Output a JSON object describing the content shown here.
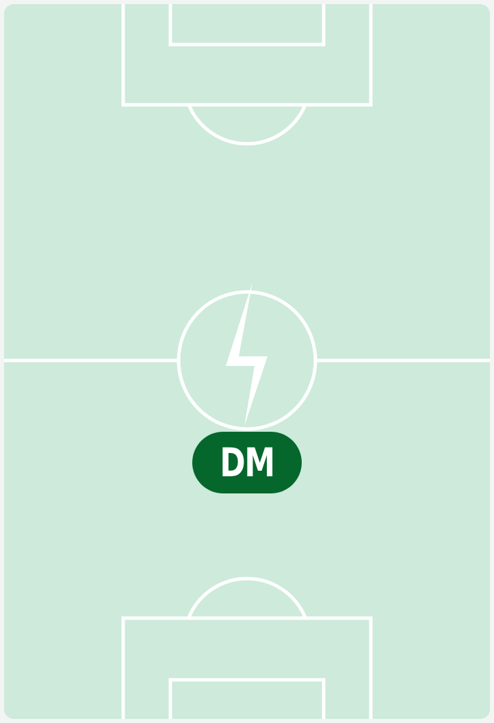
{
  "pitch": {
    "surface_color": "#cdeadb",
    "line_color": "#ffffff",
    "frame_color": "#f3f5f4"
  },
  "center_icon": {
    "name": "lightning-bolt-icon"
  },
  "position_badge": {
    "label": "DM",
    "background_color": "#05672b",
    "text_color": "#ffffff"
  }
}
